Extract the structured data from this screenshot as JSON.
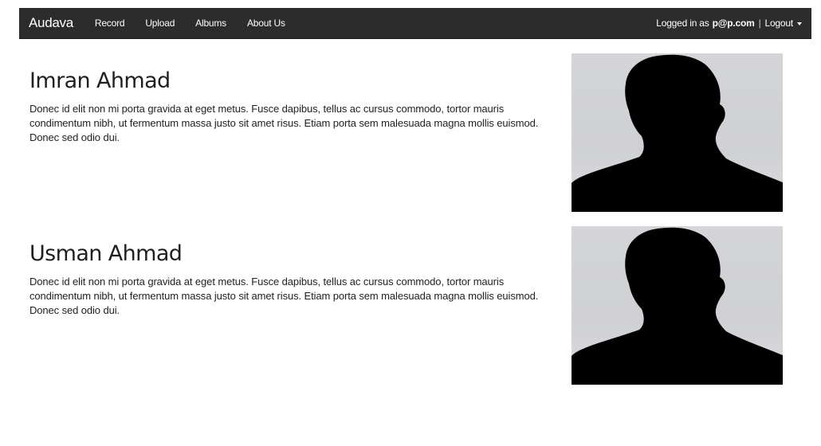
{
  "nav": {
    "brand": "Audava",
    "links": [
      "Record",
      "Upload",
      "Albums",
      "About Us"
    ],
    "logged_in_prefix": "Logged in as",
    "user": "p@p.com",
    "separator": "|",
    "logout": "Logout"
  },
  "profiles": [
    {
      "name": "Imran Ahmad",
      "bio": "Donec id elit non mi porta gravida at eget metus. Fusce dapibus, tellus ac cursus commodo, tortor mauris condimentum nibh, ut fermentum massa justo sit amet risus. Etiam porta sem malesuada magna mollis euismod. Donec sed odio dui."
    },
    {
      "name": "Usman Ahmad",
      "bio": "Donec id elit non mi porta gravida at eget metus. Fusce dapibus, tellus ac cursus commodo, tortor mauris condimentum nibh, ut fermentum massa justo sit amet risus. Etiam porta sem malesuada magna mollis euismod. Donec sed odio dui."
    }
  ],
  "icons": {
    "caret": "caret-down-icon",
    "avatar": "person-silhouette"
  },
  "colors": {
    "navbar": "#2c2c2c",
    "nav_text": "#ffffff",
    "text": "#1f1f1f",
    "photo_bg": "#d4d5d9",
    "silhouette": "#000000"
  }
}
